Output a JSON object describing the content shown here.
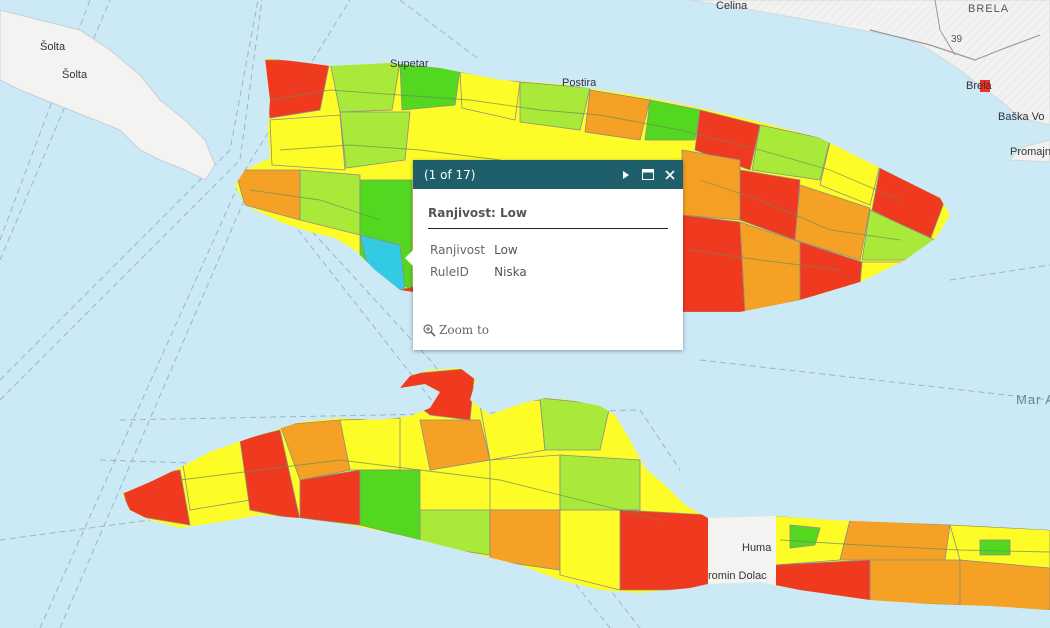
{
  "map": {
    "places": {
      "celina": "Celina",
      "brela": "BRELA",
      "route": "39",
      "solta_1": "Šolta",
      "solta_2": "Šolta",
      "supetar": "Supetar",
      "postira": "Postira",
      "brela_town": "Brela",
      "baska_voda": "Baška Vo",
      "promajna": "Promajn",
      "mar": "Mar A",
      "huma": "Huma",
      "promin_dolac": "romin Dolac"
    },
    "legend_colors": {
      "very_low": "#4ad620",
      "low": "#a4e83c",
      "medium": "#fefc28",
      "high": "#f59c25",
      "very_high": "#f03020"
    }
  },
  "popup": {
    "count": "(1 of 17)",
    "title": "Ranjivost: Low",
    "rows": [
      {
        "attr": "Ranjivost",
        "value": "Low"
      },
      {
        "attr": "RuleID",
        "value": "Niska"
      }
    ],
    "zoom_label": "Zoom to",
    "header_color": "#1f5f6b"
  }
}
